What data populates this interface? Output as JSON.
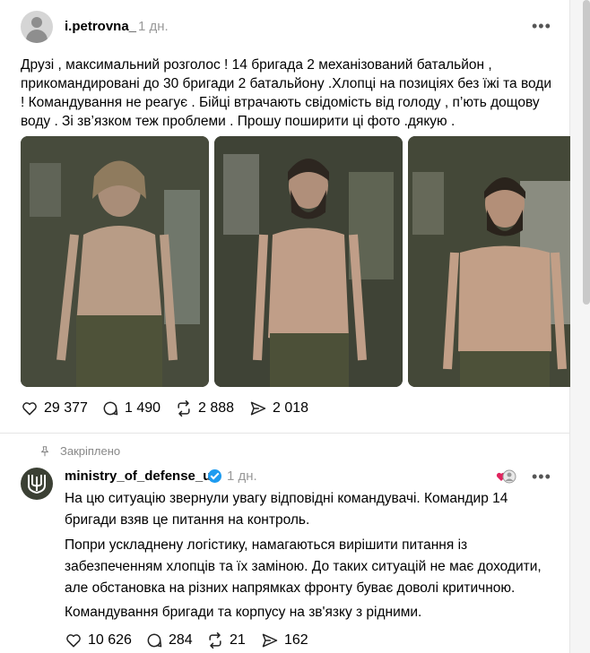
{
  "post": {
    "username": "i.petrovna_",
    "time": "1 дн.",
    "text": "Друзі , максимальний розголос ! 14 бригада 2 механізований батальйон , прикомандировані до 30 бригади 2 батальйону .Хлопці на позиціях без їжі та води ! Командування не реагує . Бійці втрачають свідомість від голоду , п’ють дощову воду . Зі зв’язком теж проблеми . Прошу поширити ці фото .дякую .",
    "stats": {
      "likes": "29 377",
      "comments": "1 490",
      "reposts": "2 888",
      "shares": "2 018"
    }
  },
  "pinned_label": "Закріплено",
  "reply": {
    "username": "ministry_of_defense_ua",
    "time": "1 дн.",
    "paragraphs": [
      "На цю ситуацію звернули увагу відповідні командувачі. Командир 14 бригади взяв це питання на контроль.",
      "Попри ускладнену логістику, намагаються вирішити питання із забезпеченням хлопців та їх заміною. До таких ситуацій не має доходити, але обстановка на різних напрямках фронту буває доволі критичною.",
      "Командування бригади та корпусу на зв'язку з рідними."
    ],
    "stats": {
      "likes": "10 626",
      "comments": "284",
      "reposts": "21",
      "shares": "162"
    }
  },
  "icons": {
    "more": "more-horizontal-icon",
    "like": "heart-icon",
    "comment": "comment-bubble-icon",
    "repost": "repost-icon",
    "share": "send-icon",
    "pin": "pin-icon",
    "verified": "verified-badge-icon"
  },
  "colors": {
    "verified": "#1d9bf0",
    "muted": "#999999",
    "divider": "#e5e5e5"
  }
}
